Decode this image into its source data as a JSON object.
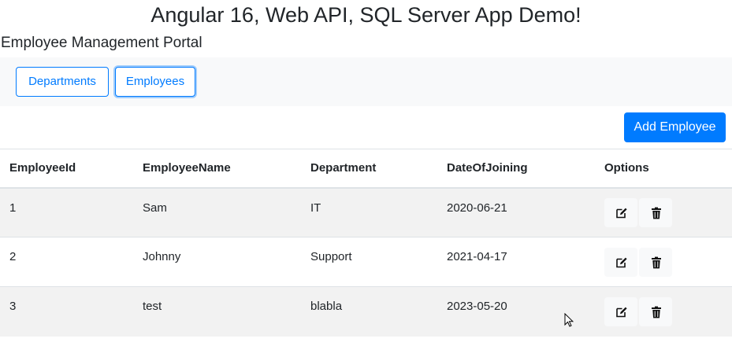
{
  "app_title": "Angular 16, Web API, SQL Server App Demo!",
  "portal_title": "Employee Management Portal",
  "nav": {
    "departments_label": "Departments",
    "employees_label": "Employees"
  },
  "add_button_label": "Add Employee",
  "table": {
    "headers": [
      "EmployeeId",
      "EmployeeName",
      "Department",
      "DateOfJoining",
      "Options"
    ],
    "rows": [
      {
        "id": "1",
        "name": "Sam",
        "department": "IT",
        "date": "2020-06-21"
      },
      {
        "id": "2",
        "name": "Johnny",
        "department": "Support",
        "date": "2021-04-17"
      },
      {
        "id": "3",
        "name": "test",
        "department": "blabla",
        "date": "2023-05-20"
      }
    ]
  },
  "icons": {
    "edit": "edit-icon",
    "delete": "trash-icon"
  },
  "colors": {
    "primary": "#007bff",
    "navbar_bg": "#f8f9fa",
    "striped_row": "#f2f2f2"
  }
}
